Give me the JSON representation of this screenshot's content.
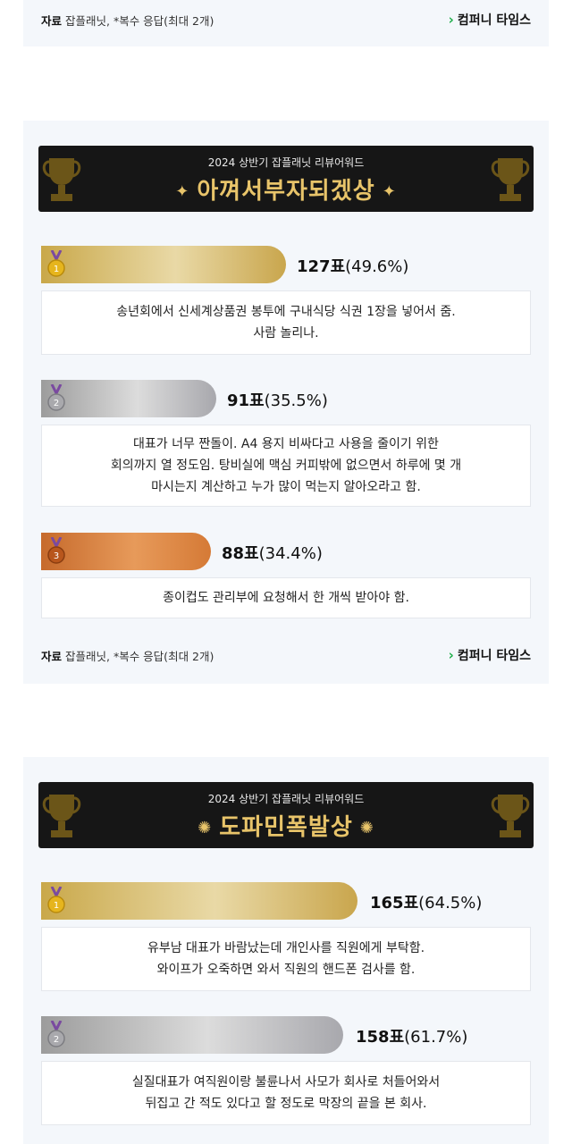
{
  "source": {
    "label": "자료",
    "text": "잡플래닛, *복수 응답(최대 2개)"
  },
  "brand": {
    "chevron": "›",
    "name": "컴퍼니 타임스"
  },
  "awards": [
    {
      "subtitle": "2024 상반기 잡플래닛 리뷰어워드",
      "title": "아껴서부자되겠상",
      "entries": [
        {
          "rank": "1",
          "votes": "127표",
          "pct": "(49.6%)",
          "percent": 49.6,
          "lines": [
            "송년회에서 신세계상품권 봉투에 구내식당 식권 1장을 넣어서 줌.",
            "사람 놀리나."
          ]
        },
        {
          "rank": "2",
          "votes": "91표",
          "pct": "(35.5%)",
          "percent": 35.5,
          "lines": [
            "대표가 너무 짠돌이. A4 용지 비싸다고 사용을 줄이기 위한",
            "회의까지 열 정도임. 탕비실에 맥심 커피밖에 없으면서 하루에 몇 개",
            "마시는지 계산하고 누가 많이 먹는지 알아오라고 함."
          ]
        },
        {
          "rank": "3",
          "votes": "88표",
          "pct": "(34.4%)",
          "percent": 34.4,
          "lines": [
            "종이컵도 관리부에 요청해서 한 개씩 받아야 함."
          ]
        }
      ]
    },
    {
      "subtitle": "2024 상반기 잡플래닛 리뷰어워드",
      "title": "도파민폭발상",
      "entries": [
        {
          "rank": "1",
          "votes": "165표",
          "pct": "(64.5%)",
          "percent": 64.5,
          "lines": [
            "유부남 대표가 바람났는데 개인사를 직원에게 부탁함.",
            "와이프가 오죽하면 와서 직원의 핸드폰 검사를 함."
          ]
        },
        {
          "rank": "2",
          "votes": "158표",
          "pct": "(61.7%)",
          "percent": 61.7,
          "lines": [
            "실질대표가 여직원이랑 불륜나서 사모가 회사로 처들어와서",
            "뒤집고 간 적도 있다고 할 정도로 막장의 끝을 본 회사."
          ]
        }
      ]
    }
  ],
  "colors": {
    "gold": "#d4b566",
    "silver": "#bdbdbf",
    "bronze": "#d97f3c",
    "brand_green": "#1fae4a",
    "banner_bg": "#161616",
    "title_gold": "#e8c46a"
  }
}
